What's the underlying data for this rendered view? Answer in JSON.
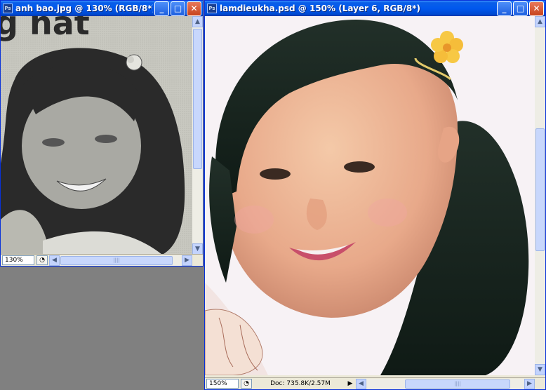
{
  "windows": [
    {
      "title": "anh bao.jpg @ 130% (RGB/8*)",
      "zoom": "130%",
      "app_icon": "photoshop-icon",
      "scroll": {
        "v_thumb": "▬",
        "h_thumb": "||||"
      }
    },
    {
      "title": "lamdieukha.psd @ 150% (Layer 6, RGB/8*)",
      "zoom": "150%",
      "doc_info": "Doc: 735.8K/2.57M",
      "app_icon": "photoshop-icon",
      "scroll": {
        "v_thumb": "▬",
        "h_thumb": "||||"
      }
    }
  ],
  "buttons": {
    "minimize": "_",
    "maximize": "□",
    "close": "✕",
    "info": "◔",
    "play": "▶"
  },
  "photo_text": "g hat",
  "colors": {
    "titlebar": "#0058ee",
    "desktop": "#808080",
    "chrome": "#ece9d8",
    "close": "#c7421d"
  }
}
